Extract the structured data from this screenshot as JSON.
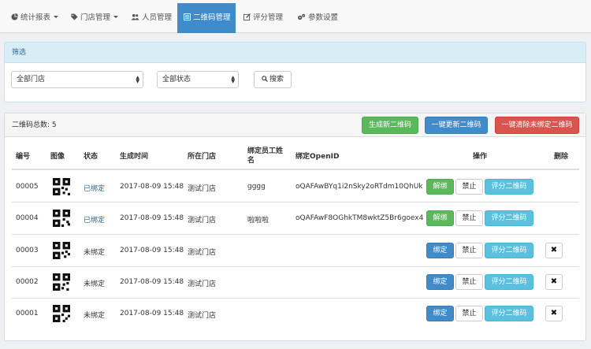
{
  "nav": {
    "items": [
      {
        "label": "统计报表",
        "icon": "pie-chart-icon",
        "dropdown": true
      },
      {
        "label": "门店管理",
        "icon": "tag-icon",
        "dropdown": true
      },
      {
        "label": "人员管理",
        "icon": "users-icon",
        "dropdown": false
      },
      {
        "label": "二维码管理",
        "icon": "list-icon",
        "dropdown": false,
        "active": true
      },
      {
        "label": "评分管理",
        "icon": "edit-icon",
        "dropdown": false
      },
      {
        "label": "参数设置",
        "icon": "gears-icon",
        "dropdown": false
      }
    ]
  },
  "filter": {
    "title": "筛选",
    "store_select": "全部门店",
    "status_select": "全部状态",
    "search_label": "搜索"
  },
  "list": {
    "total_label": "二维码总数: 5",
    "create_label": "生成新二维码",
    "update_all_label": "一键更新二维码",
    "clear_unbound_label": "一键清除未绑定二维码",
    "headers": {
      "id": "编号",
      "image": "图像",
      "status": "状态",
      "created": "生成时间",
      "store": "所在门店",
      "employee": "绑定员工姓名",
      "openid": "绑定OpenID",
      "actions": "操作",
      "delete": "删除"
    },
    "rows": [
      {
        "id": "00005",
        "status": "已绑定",
        "created": "2017-08-09 15:48",
        "store": "测试门店",
        "employee": "gggg",
        "openid": "oQAFAwBYq1i2nSky2oRTdm10QhUk",
        "bind_label": "解绑",
        "disable_label": "禁止",
        "rate_label": "评分二维码"
      },
      {
        "id": "00004",
        "status": "已绑定",
        "created": "2017-08-09 15:48",
        "store": "测试门店",
        "employee": "啦啦啦",
        "openid": "oQAFAwF8OGhkTM8wktZ5Br6goex4",
        "bind_label": "解绑",
        "disable_label": "禁止",
        "rate_label": "评分二维码"
      },
      {
        "id": "00003",
        "status": "未绑定",
        "created": "2017-08-09 15:48",
        "store": "测试门店",
        "employee": "",
        "openid": "",
        "bind_label": "绑定",
        "disable_label": "禁止",
        "rate_label": "评分二维码",
        "delete_label": "✖"
      },
      {
        "id": "00002",
        "status": "未绑定",
        "created": "2017-08-09 15:48",
        "store": "测试门店",
        "employee": "",
        "openid": "",
        "bind_label": "绑定",
        "disable_label": "禁止",
        "rate_label": "评分二维码",
        "delete_label": "✖"
      },
      {
        "id": "00001",
        "status": "未绑定",
        "created": "2017-08-09 15:48",
        "store": "测试门店",
        "employee": "",
        "openid": "",
        "bind_label": "绑定",
        "disable_label": "禁止",
        "rate_label": "评分二维码",
        "delete_label": "✖"
      }
    ]
  },
  "colors": {
    "primary": "#428bca",
    "success": "#5cb85c",
    "danger": "#d9534f",
    "info": "#5bc0de",
    "bound_text": "#2a6496"
  }
}
